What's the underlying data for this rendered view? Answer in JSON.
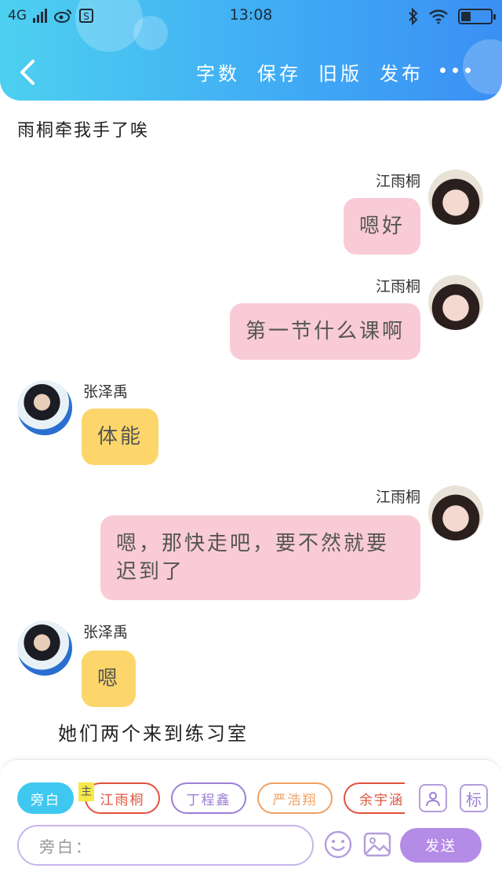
{
  "statusbar": {
    "network": "4G",
    "time": "13:08"
  },
  "toolbar": {
    "actions": [
      "字数",
      "保存",
      "旧版",
      "发布"
    ],
    "more_label": "•••"
  },
  "story": {
    "title": "雨桐牵我手了唉",
    "narration": "她们两个来到练习室"
  },
  "messages": [
    {
      "speaker": "江雨桐",
      "text": "嗯好",
      "side": "right",
      "color": "pink"
    },
    {
      "speaker": "江雨桐",
      "text": "第一节什么课啊",
      "side": "right",
      "color": "pink"
    },
    {
      "speaker": "张泽禹",
      "text": "体能",
      "side": "left",
      "color": "yellow"
    },
    {
      "speaker": "江雨桐",
      "text": "嗯，那快走吧，要不然就要迟到了",
      "side": "right",
      "color": "pink"
    },
    {
      "speaker": "张泽禹",
      "text": "嗯",
      "side": "left",
      "color": "yellow"
    }
  ],
  "composer": {
    "role_chips": [
      {
        "label": "旁白",
        "color": "#3fc8ef"
      },
      {
        "label": "江雨桐",
        "color": "#e0523c"
      },
      {
        "label": "丁程鑫",
        "color": "#9c7ed6"
      },
      {
        "label": "严浩翔",
        "color": "#f0a060"
      },
      {
        "label": "余宇涵",
        "color": "#e0523c"
      }
    ],
    "main_tag": "主",
    "tag_icon_label": "标",
    "input_placeholder": "旁白：",
    "send_label": "发送"
  },
  "colors": {
    "header_gradient_start": "#4dd0f0",
    "header_gradient_end": "#3b8ff3",
    "pink_bubble": "#f9cbd6",
    "yellow_bubble": "#fcd66a",
    "send_button": "#b48be6"
  }
}
